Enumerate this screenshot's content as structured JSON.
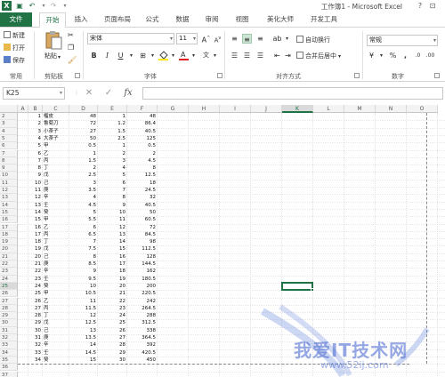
{
  "titlebar": {
    "title": "工作簿1 - Microsoft Excel",
    "logo": "X",
    "qat_icons": [
      "save-icon",
      "undo-icon",
      "redo-icon",
      "customize-icon"
    ]
  },
  "tabs": {
    "file": "文件",
    "items": [
      "开始",
      "插入",
      "页面布局",
      "公式",
      "数据",
      "审阅",
      "视图",
      "美化大师",
      "开发工具"
    ],
    "active": "开始"
  },
  "ribbon": {
    "common": {
      "new": "新建",
      "open": "打开",
      "save": "保存",
      "label": "常用"
    },
    "clipboard": {
      "paste": "粘贴",
      "label": "剪贴板"
    },
    "font": {
      "name": "宋体",
      "size": "11",
      "bold": "B",
      "italic": "I",
      "underline": "U",
      "grow": "A",
      "shrink": "A",
      "label": "字体"
    },
    "alignment": {
      "wrap": "自动换行",
      "merge": "合并后居中",
      "label": "对齐方式"
    },
    "number": {
      "format": "常规",
      "percent": "%",
      "comma": ",",
      "label": "数字"
    },
    "colors": {
      "fill": "#ffe600",
      "font": "#e02020",
      "accent": "#217346"
    }
  },
  "formula_bar": {
    "namebox": "K25",
    "fx": "fx",
    "value": ""
  },
  "grid": {
    "columns": [
      "A",
      "B",
      "C",
      "D",
      "E",
      "F",
      "G",
      "H",
      "I",
      "J",
      "K",
      "L",
      "M",
      "N",
      "O"
    ],
    "selected_column": "K",
    "selected_row": "25",
    "rows": [
      {
        "r": "2",
        "b": "1",
        "c": "榴皮",
        "d": "48",
        "e": "1",
        "f": "48"
      },
      {
        "r": "3",
        "b": "2",
        "c": "鲁菊刀",
        "d": "72",
        "e": "1.2",
        "f": "86.4"
      },
      {
        "r": "4",
        "b": "3",
        "c": "小茶子",
        "d": "27",
        "e": "1.5",
        "f": "40.5"
      },
      {
        "r": "5",
        "b": "4",
        "c": "大茶子",
        "d": "50",
        "e": "2.5",
        "f": "125"
      },
      {
        "r": "6",
        "b": "5",
        "c": "甲",
        "d": "0.5",
        "e": "1",
        "f": "0.5"
      },
      {
        "r": "7",
        "b": "6",
        "c": "乙",
        "d": "1",
        "e": "2",
        "f": "2"
      },
      {
        "r": "8",
        "b": "7",
        "c": "丙",
        "d": "1.5",
        "e": "3",
        "f": "4.5"
      },
      {
        "r": "9",
        "b": "8",
        "c": "丁",
        "d": "2",
        "e": "4",
        "f": "8"
      },
      {
        "r": "10",
        "b": "9",
        "c": "戊",
        "d": "2.5",
        "e": "5",
        "f": "12.5"
      },
      {
        "r": "11",
        "b": "10",
        "c": "己",
        "d": "3",
        "e": "6",
        "f": "18"
      },
      {
        "r": "12",
        "b": "11",
        "c": "庚",
        "d": "3.5",
        "e": "7",
        "f": "24.5"
      },
      {
        "r": "13",
        "b": "12",
        "c": "辛",
        "d": "4",
        "e": "8",
        "f": "32"
      },
      {
        "r": "14",
        "b": "13",
        "c": "壬",
        "d": "4.5",
        "e": "9",
        "f": "40.5"
      },
      {
        "r": "15",
        "b": "14",
        "c": "癸",
        "d": "5",
        "e": "10",
        "f": "50"
      },
      {
        "r": "16",
        "b": "15",
        "c": "甲",
        "d": "5.5",
        "e": "11",
        "f": "60.5"
      },
      {
        "r": "17",
        "b": "16",
        "c": "乙",
        "d": "6",
        "e": "12",
        "f": "72"
      },
      {
        "r": "18",
        "b": "17",
        "c": "丙",
        "d": "6.5",
        "e": "13",
        "f": "84.5"
      },
      {
        "r": "19",
        "b": "18",
        "c": "丁",
        "d": "7",
        "e": "14",
        "f": "98"
      },
      {
        "r": "20",
        "b": "19",
        "c": "戊",
        "d": "7.5",
        "e": "15",
        "f": "112.5"
      },
      {
        "r": "21",
        "b": "20",
        "c": "己",
        "d": "8",
        "e": "16",
        "f": "128"
      },
      {
        "r": "22",
        "b": "21",
        "c": "庚",
        "d": "8.5",
        "e": "17",
        "f": "144.5"
      },
      {
        "r": "23",
        "b": "22",
        "c": "辛",
        "d": "9",
        "e": "18",
        "f": "162"
      },
      {
        "r": "24",
        "b": "23",
        "c": "壬",
        "d": "9.5",
        "e": "19",
        "f": "180.5"
      },
      {
        "r": "25",
        "b": "24",
        "c": "癸",
        "d": "10",
        "e": "20",
        "f": "200"
      },
      {
        "r": "26",
        "b": "25",
        "c": "甲",
        "d": "10.5",
        "e": "21",
        "f": "220.5"
      },
      {
        "r": "27",
        "b": "26",
        "c": "乙",
        "d": "11",
        "e": "22",
        "f": "242"
      },
      {
        "r": "28",
        "b": "27",
        "c": "丙",
        "d": "11.5",
        "e": "23",
        "f": "264.5"
      },
      {
        "r": "29",
        "b": "28",
        "c": "丁",
        "d": "12",
        "e": "24",
        "f": "288"
      },
      {
        "r": "30",
        "b": "29",
        "c": "戊",
        "d": "12.5",
        "e": "25",
        "f": "312.5"
      },
      {
        "r": "31",
        "b": "30",
        "c": "己",
        "d": "13",
        "e": "26",
        "f": "338"
      },
      {
        "r": "32",
        "b": "31",
        "c": "庚",
        "d": "13.5",
        "e": "27",
        "f": "364.5"
      },
      {
        "r": "33",
        "b": "32",
        "c": "辛",
        "d": "14",
        "e": "28",
        "f": "392"
      },
      {
        "r": "34",
        "b": "33",
        "c": "壬",
        "d": "14.5",
        "e": "29",
        "f": "420.5"
      },
      {
        "r": "35",
        "b": "34",
        "c": "癸",
        "d": "15",
        "e": "30",
        "f": "450"
      },
      {
        "r": "36",
        "b": "",
        "c": "",
        "d": "",
        "e": "",
        "f": ""
      },
      {
        "r": "37",
        "b": "",
        "c": "",
        "d": "",
        "e": "",
        "f": ""
      }
    ]
  },
  "watermark": {
    "text": "我爱IT技术网",
    "url": "www.52ij.com"
  }
}
